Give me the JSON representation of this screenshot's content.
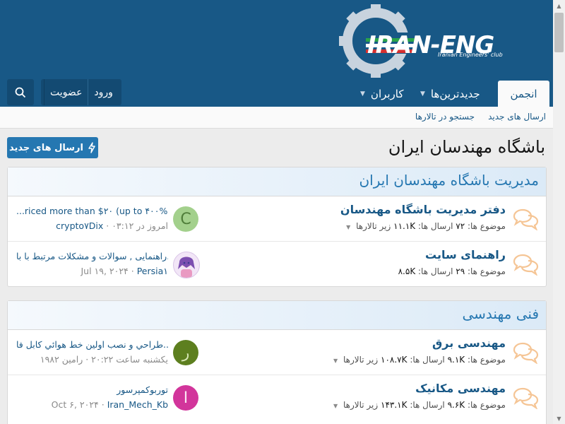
{
  "header": {
    "logo_text": "IRAN-ENG",
    "logo_sub": "Iranian Engineers' club"
  },
  "nav": {
    "tabs": [
      {
        "label": "انجمن",
        "active": true
      },
      {
        "label": "جدیدترین‌ها",
        "dropdown": true
      },
      {
        "label": "کاربران",
        "dropdown": true
      }
    ],
    "login": "ورود",
    "register": "عضویت",
    "search_icon": "search-icon"
  },
  "subnav": {
    "new_posts": "ارسال های جدید",
    "search_forums": "جستجو در تالارها"
  },
  "page": {
    "title": "باشگاه مهندسان ایران",
    "new_posts_button": "ارسال های جدید"
  },
  "categories": [
    {
      "title": "مدیریت باشگاه مهندسان ایران",
      "nodes": [
        {
          "title": "دفتر مدیریت باشگاه مهندسان",
          "threads_label": "موضوع ها:",
          "threads": "۷۲",
          "messages_label": "ارسال ها:",
          "messages": "۱۱.۱K",
          "subforums": "زیر تالارها",
          "avatar_letter": "C",
          "avatar_color": "#a3d08c",
          "latest_title": "...riced more than $۲۰ (up to ۴۰۰%)",
          "latest_time": "امروز در ۰۳:۱۲",
          "latest_user": "crypto۷Dix"
        },
        {
          "title": "راهنمای سایت",
          "threads_label": "موضوع ها:",
          "threads": "۲۹",
          "messages_label": "ارسال ها:",
          "messages": "۸.۵K",
          "subforums": "",
          "avatar_letter": "",
          "avatar_color": "#f2e6f7",
          "latest_title": "راهنمایی , سوالات و مشکلات مرتبط با با...",
          "latest_time": "Jul ۱۹, ۲۰۲۴",
          "latest_user": "Persia۱"
        }
      ]
    },
    {
      "title": "فنی مهندسی",
      "nodes": [
        {
          "title": "مهندسی برق",
          "threads_label": "موضوع ها:",
          "threads": "۹.۱K",
          "messages_label": "ارسال ها:",
          "messages": "۱۰۸.۷K",
          "subforums": "زیر تالارها",
          "avatar_letter": "ر",
          "avatar_color": "#5d7f1f",
          "latest_title": "طراحي و نصب اولين خط هوائي كابل فا...",
          "latest_time": "یکشنبه ساعت ۲۰:۲۲",
          "latest_user": "رامین ۱۹۸۲"
        },
        {
          "title": "مهندسی مکانیک",
          "threads_label": "موضوع ها:",
          "threads": "۹.۶K",
          "messages_label": "ارسال ها:",
          "messages": "۱۴۳.۱K",
          "subforums": "زیر تالارها",
          "avatar_letter": "I",
          "avatar_color": "#d2359b",
          "latest_title": "توربوکمپرسور",
          "latest_time": "Oct ۶, ۲۰۲۴",
          "latest_user": "Iran_Mech_Kb"
        }
      ]
    }
  ]
}
